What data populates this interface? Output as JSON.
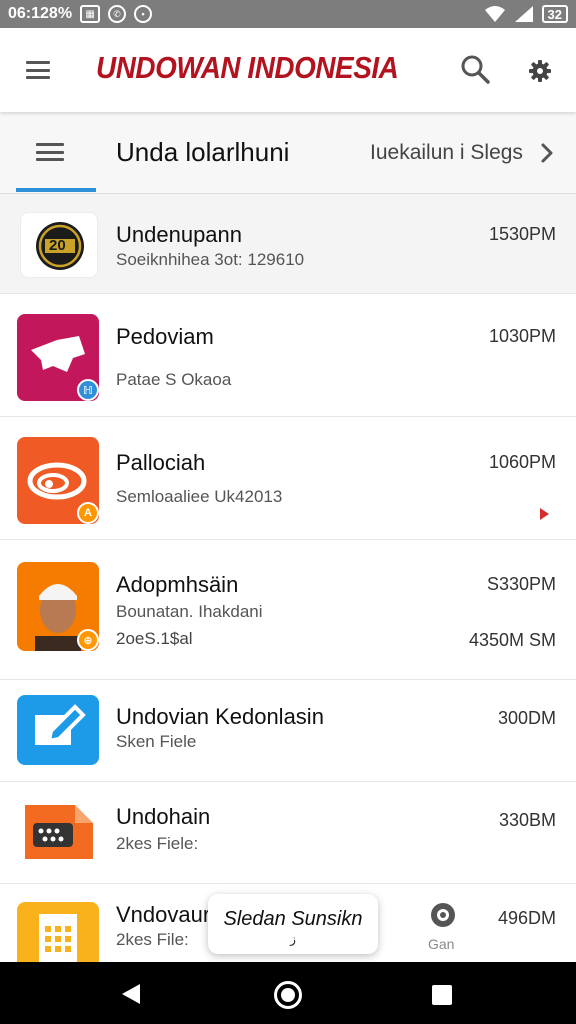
{
  "status_bar": {
    "time": "06:128%",
    "battery": "32"
  },
  "app_bar": {
    "title": "UNDOWAN INDONESIA"
  },
  "tab_bar": {
    "title": "Unda lolarlhuni",
    "right_label": "Iuekailun i Slegs"
  },
  "rows": [
    {
      "name": "Undenupann",
      "sub": "Soeiknhihea 3ot: 129610",
      "time": "1530PM",
      "thumb_text": "20"
    },
    {
      "name": "Pedoviam",
      "sub": "Patae S Okaoa",
      "time": "1030PM"
    },
    {
      "name": "Pallociah",
      "sub": "Semloaaliee Uk42013",
      "time": "1060PM"
    },
    {
      "name": "Adopmhsäin",
      "sub": "Bounatan. Ihakdani",
      "sub2": "2oeS.1$al",
      "time": "S330PM",
      "extra": "4350M SM"
    },
    {
      "name": "Undovian Kedonlasin",
      "sub": "Sken Fiele",
      "time": "300DM"
    },
    {
      "name": "Undohain",
      "sub": "2kes Fiele:",
      "time": "330BM"
    },
    {
      "name": "Vndovaur",
      "sub": "2kes File:",
      "time": "496DM"
    }
  ],
  "toast": {
    "text": "Sledan Sunsikn",
    "sub": "ز"
  },
  "floating": {
    "label": "Gan"
  },
  "colors": {
    "brand_red": "#b3121f",
    "tab_indicator": "#2f8fd8",
    "status_bar": "#7d7d7d",
    "nav_bar": "#000000"
  }
}
